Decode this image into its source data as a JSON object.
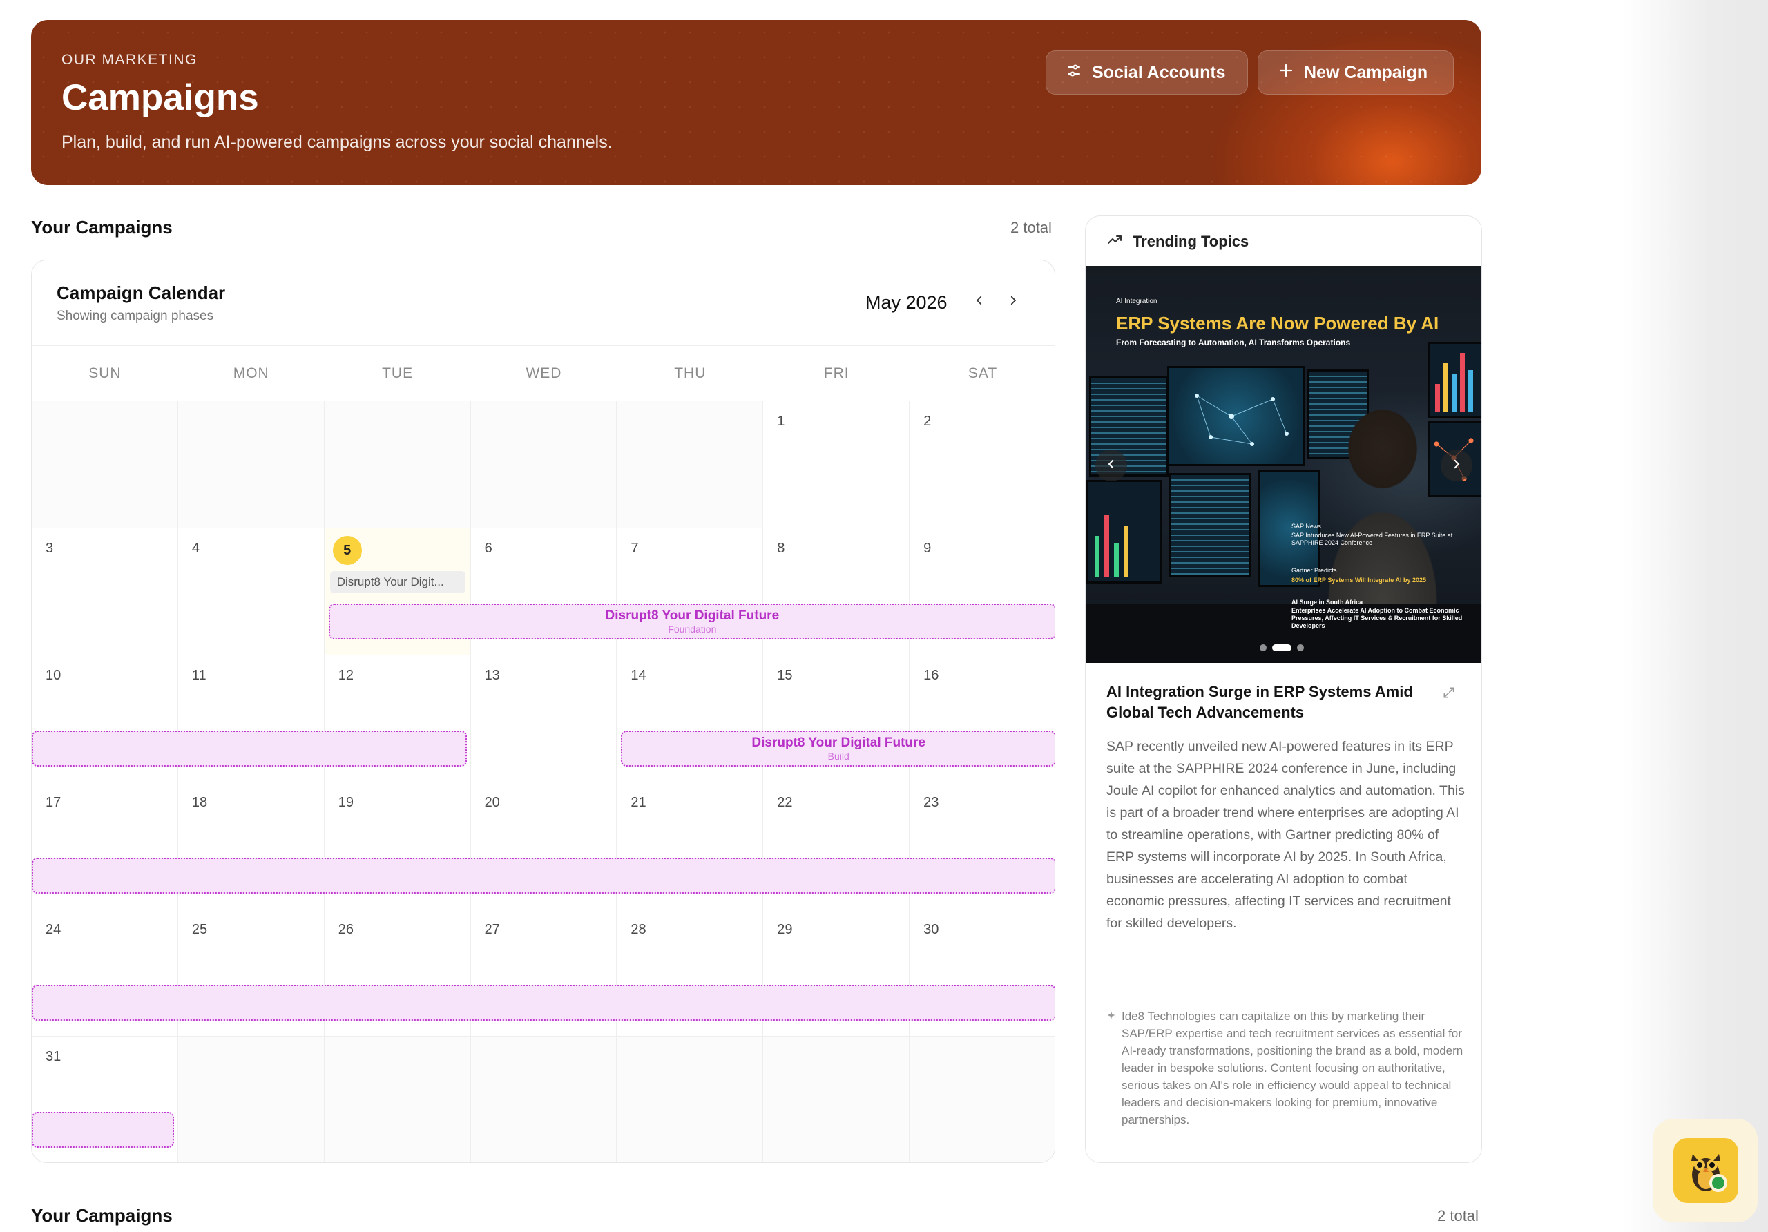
{
  "hero": {
    "eyebrow": "OUR MARKETING",
    "title": "Campaigns",
    "subtitle": "Plan, build, and run AI-powered campaigns across your social channels.",
    "social_accounts_label": "Social Accounts",
    "new_campaign_label": "New Campaign"
  },
  "campaigns_section": {
    "title": "Your Campaigns",
    "count": "2 total"
  },
  "campaigns_section_bottom": {
    "title": "Your Campaigns",
    "count": "2 total"
  },
  "calendar": {
    "title": "Campaign Calendar",
    "subtitle": "Showing campaign phases",
    "month": "May 2026",
    "weekdays": [
      "SUN",
      "MON",
      "TUE",
      "WED",
      "THU",
      "FRI",
      "SAT"
    ],
    "weeks": [
      [
        "",
        "",
        "",
        "",
        "",
        "1",
        "2"
      ],
      [
        "3",
        "4",
        "5",
        "6",
        "7",
        "8",
        "9"
      ],
      [
        "10",
        "11",
        "12",
        "13",
        "14",
        "15",
        "16"
      ],
      [
        "17",
        "18",
        "19",
        "20",
        "21",
        "22",
        "23"
      ],
      [
        "24",
        "25",
        "26",
        "27",
        "28",
        "29",
        "30"
      ],
      [
        "31",
        "",
        "",
        "",
        "",
        "",
        ""
      ]
    ],
    "today": "5",
    "event_chip": "Disrupt8 Your Digit...",
    "phases": [
      {
        "name": "Disrupt8 Your Digital Future",
        "phase": "Foundation"
      },
      {
        "name": "",
        "phase": ""
      },
      {
        "name": "Disrupt8 Your Digital Future",
        "phase": "Build"
      },
      {
        "name": "",
        "phase": ""
      },
      {
        "name": "",
        "phase": ""
      },
      {
        "name": "",
        "phase": ""
      }
    ]
  },
  "trending": {
    "header": "Trending Topics",
    "image": {
      "kicker": "AI Integration",
      "title": "ERP Systems Are Now Powered By AI",
      "subtitle": "From Forecasting to Automation, AI Transforms Operations",
      "captions": [
        {
          "label": "SAP News",
          "text": "SAP Introduces New AI-Powered Features in ERP Suite at SAPPHIRE 2024 Conference"
        },
        {
          "label": "Gartner Predicts",
          "text": "80% of ERP Systems Will Integrate AI by 2025"
        },
        {
          "label": "AI Surge in South Africa",
          "text": "Enterprises Accelerate AI Adoption to Combat Economic Pressures, Affecting IT Services & Recruitment for Skilled Developers"
        }
      ],
      "slide_count": 3,
      "active_slide": 2
    },
    "title": "AI Integration Surge in ERP Systems Amid Global Tech Advancements",
    "body": "SAP recently unveiled new AI-powered features in its ERP suite at the SAPPHIRE 2024 conference in June, including Joule AI copilot for enhanced analytics and automation. This is part of a broader trend where enterprises are adopting AI to streamline operations, with Gartner predicting 80% of ERP systems will incorporate AI by 2025. In South Africa, businesses are accelerating AI adoption to combat economic pressures, affecting IT services and recruitment for skilled developers.",
    "insight": "Ide8 Technologies can capitalize on this by marketing their SAP/ERP expertise and tech recruitment services as essential for AI-ready transformations, positioning the brand as a bold, modern leader in bespoke solutions. Content focusing on authoritative, serious takes on AI's role in efficiency would appeal to technical leaders and decision-makers looking for premium, innovative partnerships."
  },
  "icons": {
    "social": "sliders-icon",
    "new": "plus-icon",
    "trend": "trending-up-icon",
    "expand": "expand-icon",
    "assistant": "owl-mascot-icon",
    "insight": "sparkle-icon"
  },
  "colors": {
    "hero_bg": "#843012",
    "hero_glow": "#e45a18",
    "today_badge": "#fad23c",
    "phase_fill": "#f7e3fa",
    "phase_border": "#c03ad0",
    "phase_text": "#b62fc6",
    "online": "#2aa148"
  }
}
